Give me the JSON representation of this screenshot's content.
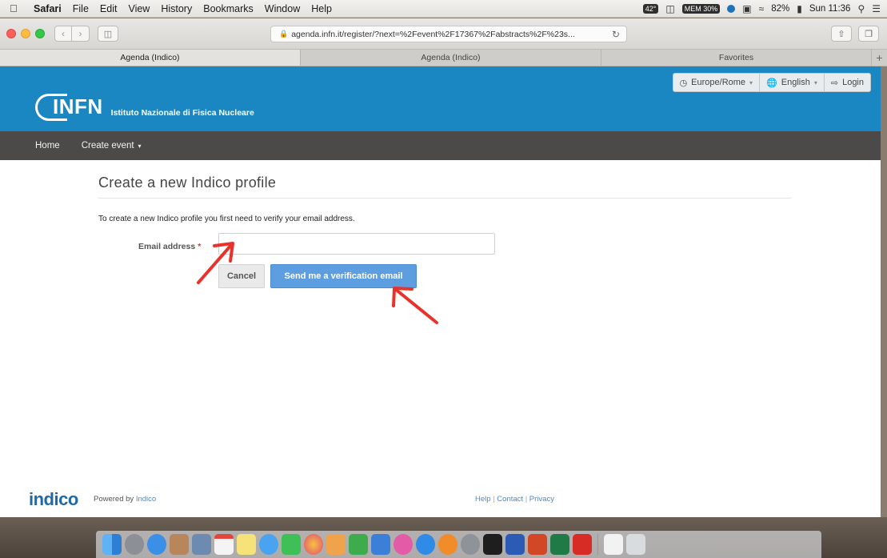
{
  "menubar": {
    "app": "Safari",
    "items": [
      "File",
      "Edit",
      "View",
      "History",
      "Bookmarks",
      "Window",
      "Help"
    ],
    "status": {
      "temp": "42°",
      "mem": "MEM 30%",
      "battery": "82%",
      "clock": "Sun 11:36"
    }
  },
  "browser": {
    "url": "agenda.infn.it/register/?next=%2Fevent%2F17367%2Fabstracts%2F%23s...",
    "tabs": [
      "Agenda (Indico)",
      "Agenda (Indico)",
      "Favorites"
    ]
  },
  "header": {
    "brand": "INFN",
    "subtitle": "Istituto Nazionale di Fisica Nucleare",
    "timezone": "Europe/Rome",
    "language": "English",
    "login": "Login"
  },
  "nav": {
    "home": "Home",
    "create_event": "Create event"
  },
  "form": {
    "title": "Create a new Indico profile",
    "intro": "To create a new Indico profile you first need to verify your email address.",
    "email_label": "Email address",
    "required_mark": "*",
    "email_value": "",
    "cancel": "Cancel",
    "send": "Send me a verification email"
  },
  "footer": {
    "logo": "indico",
    "powered_prefix": "Powered by",
    "powered_link": "Indico",
    "help": "Help",
    "contact": "Contact",
    "privacy": "Privacy",
    "separator": "|"
  },
  "colors": {
    "header_blue": "#1a86c2",
    "nav_gray": "#4b4a48",
    "send_button": "#5d9ee0",
    "annotation_red": "#e8322b"
  }
}
